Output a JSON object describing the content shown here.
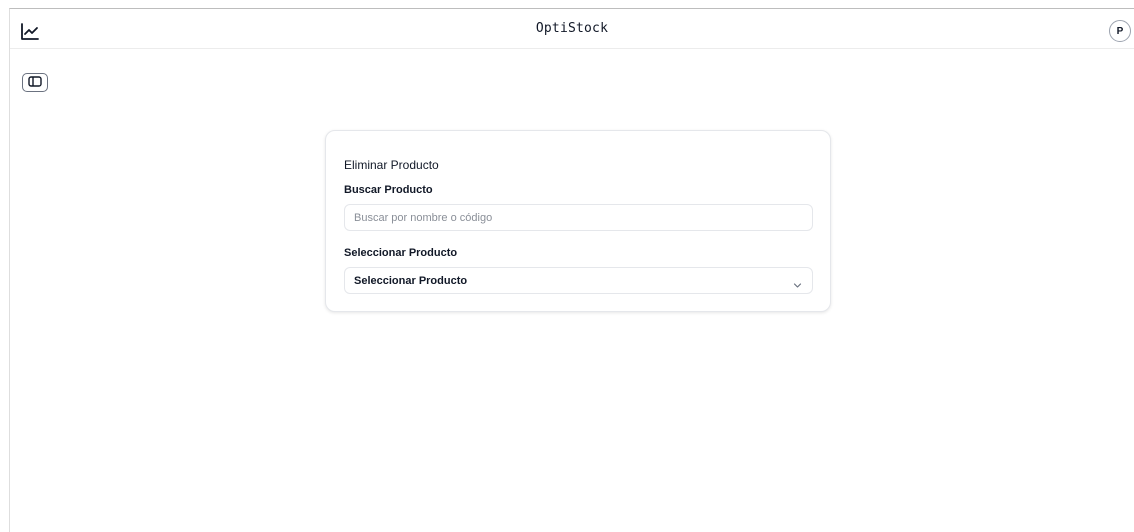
{
  "app": {
    "title": "OptiStock",
    "user_initial": "P"
  },
  "icons": {
    "logo": "line-chart-icon",
    "sidebar_toggle": "panel-left-icon",
    "select_chevron": "chevron-down-icon"
  },
  "form": {
    "title": "Eliminar Producto",
    "search": {
      "label": "Buscar Producto",
      "value": "",
      "placeholder": "Buscar por nombre o código"
    },
    "select": {
      "label": "Seleccionar Producto",
      "selected": "Seleccionar Producto"
    }
  }
}
